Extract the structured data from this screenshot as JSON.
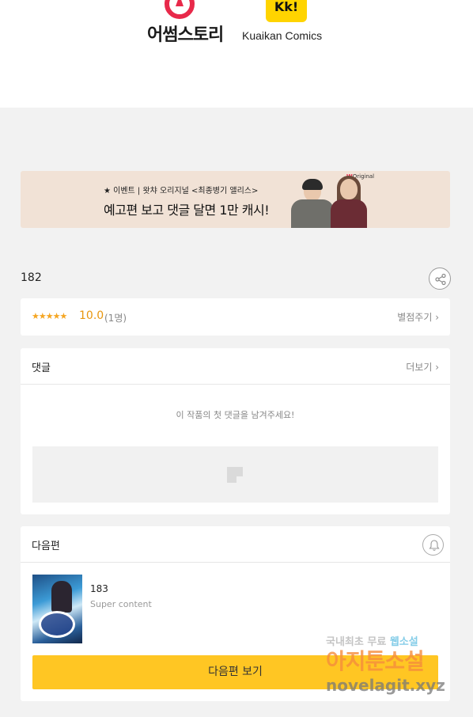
{
  "header": {
    "logo1_text": "어썸스토리",
    "logo2_mark": "Kk!",
    "logo2_text": "Kuaikan Comics"
  },
  "banner": {
    "small": "★ 이벤트 | 왓챠 오리지널 <최종병기 앨리스>",
    "big": "예고편 보고 댓글 달면 1만 캐시!",
    "badge_w": "W",
    "badge_rest": "Original"
  },
  "episode": {
    "title": "182"
  },
  "rating": {
    "stars": "★★★★★",
    "score": "10.0",
    "count": "(1명)",
    "action": "별점주기 ›"
  },
  "comments": {
    "title": "댓글",
    "more": "더보기 ›",
    "empty": "이 작품의 첫 댓글을 남겨주세요!"
  },
  "next": {
    "title": "다음편",
    "episode": "183",
    "subtitle": "Super content",
    "button": "다음편 보기"
  },
  "watermark": {
    "line1a": "국내최초 무료 ",
    "line1b": "웹소설",
    "line2": "아지툰소설",
    "line3": "novelagit.xyz"
  }
}
